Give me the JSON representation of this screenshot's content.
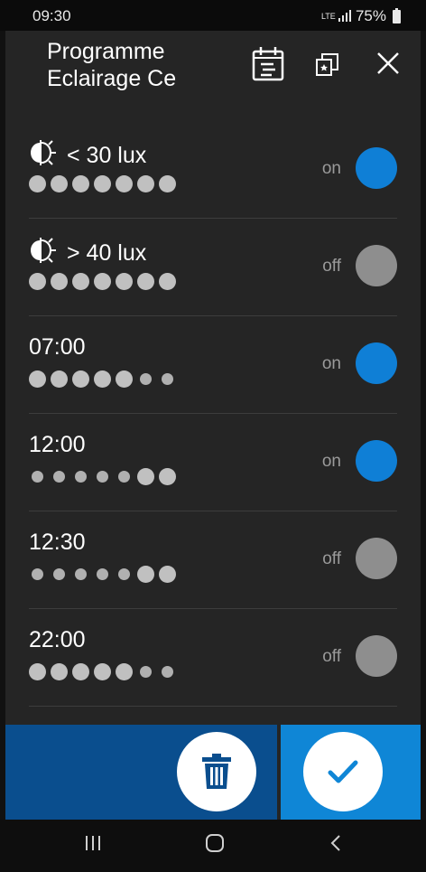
{
  "status_bar": {
    "time": "09:30",
    "network": "LTE",
    "battery": "75%"
  },
  "header": {
    "title_line1": "Programme",
    "title_line2": "Eclairage Ce",
    "icons": [
      "calendar-list-icon",
      "copy-icon",
      "close-icon"
    ]
  },
  "rows": [
    {
      "label": "< 30 lux",
      "icon": "light-sensor-icon",
      "state": "on",
      "days": [
        "big",
        "big",
        "big",
        "big",
        "big",
        "big",
        "big"
      ]
    },
    {
      "label": "> 40 lux",
      "icon": "light-sensor-icon",
      "state": "off",
      "days": [
        "big",
        "big",
        "big",
        "big",
        "big",
        "big",
        "big"
      ]
    },
    {
      "label": "07:00",
      "state": "on",
      "days": [
        "big",
        "big",
        "big",
        "big",
        "big",
        "small",
        "small"
      ]
    },
    {
      "label": "12:00",
      "state": "on",
      "days": [
        "small",
        "small",
        "small",
        "small",
        "small",
        "big",
        "big"
      ]
    },
    {
      "label": "12:30",
      "state": "off",
      "days": [
        "small",
        "small",
        "small",
        "small",
        "small",
        "big",
        "big"
      ]
    },
    {
      "label": "22:00",
      "state": "off",
      "days": [
        "big",
        "big",
        "big",
        "big",
        "big",
        "small",
        "small"
      ]
    }
  ],
  "colors": {
    "on": "#0f7fd6",
    "off": "#8e8e8e",
    "delete_bg": "#0a4e8e",
    "confirm_bg": "#0f86d6"
  },
  "actions": {
    "delete_icon": "trash-icon",
    "confirm_icon": "check-icon"
  },
  "nav": [
    "recent-apps-icon",
    "home-icon",
    "back-icon"
  ]
}
